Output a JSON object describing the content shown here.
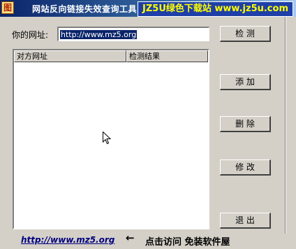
{
  "window": {
    "title": "网站反向链接失效查询工具",
    "watermark": "JZ5U绿色下载站 www.jz5u.com",
    "icon_glyph": "图"
  },
  "form": {
    "url_label": "你的网址:",
    "url_value": "http://www.mz5.org"
  },
  "list": {
    "columns": [
      "对方网址",
      "检测结果"
    ],
    "rows": []
  },
  "buttons": {
    "check": "检  测",
    "add": "添  加",
    "delete": "删  除",
    "edit": "修  改",
    "exit": "退  出"
  },
  "footer": {
    "link_text": "http://www.mz5.org",
    "arrow": "←",
    "hint": "点击访问  免装软件屋"
  }
}
